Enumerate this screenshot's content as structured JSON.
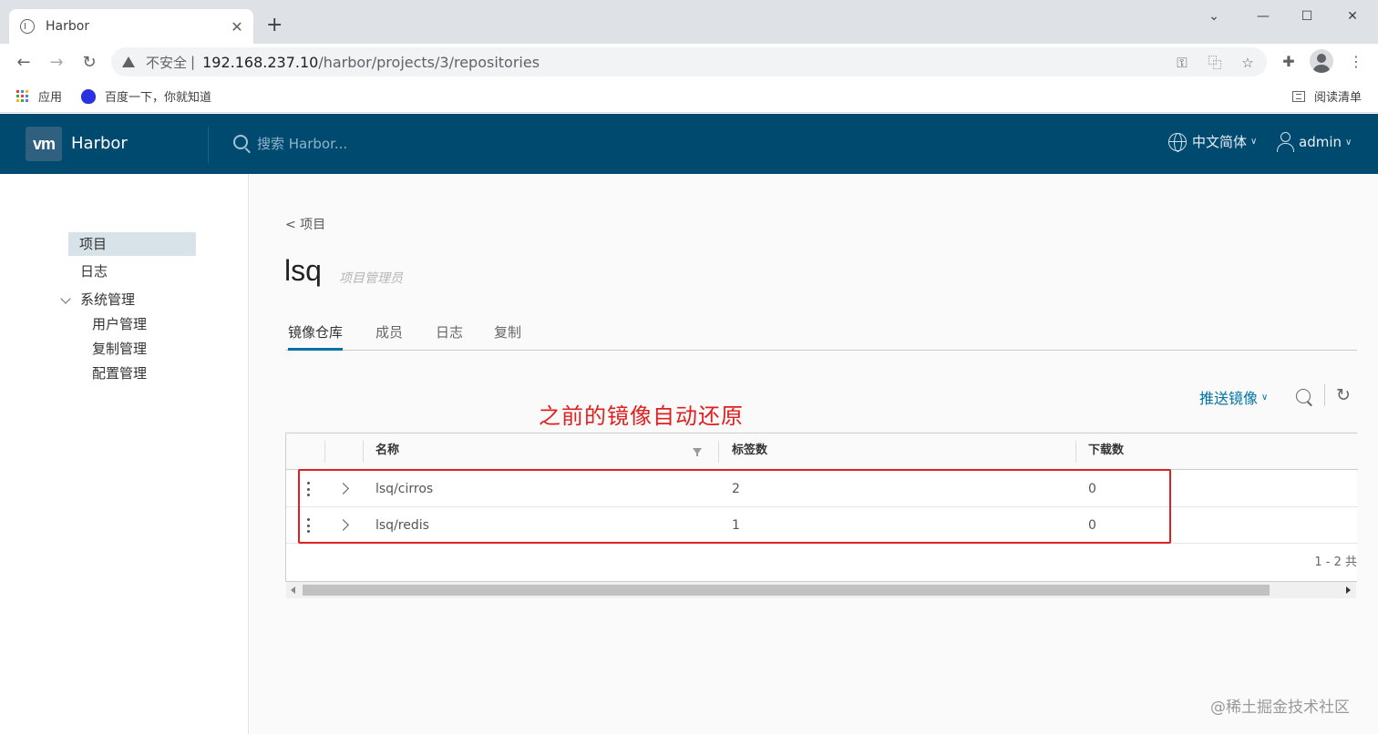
{
  "browser": {
    "tab_title": "Harbor",
    "insecure_label": "不安全",
    "url_host": "192.168.237.10",
    "url_path": "/harbor/projects/3/repositories",
    "bookmarks": [
      {
        "label": "应用"
      },
      {
        "label": "百度一下，你就知道"
      }
    ],
    "reading_list": "阅读清单"
  },
  "header": {
    "logo": "vm",
    "brand": "Harbor",
    "search_placeholder": "搜索 Harbor...",
    "language": "中文简体",
    "user": "admin",
    "color": "#004a70"
  },
  "sidebar": {
    "items": [
      {
        "label": "项目",
        "active": true
      },
      {
        "label": "日志"
      },
      {
        "label": "系统管理"
      }
    ],
    "sub_items": [
      {
        "label": "用户管理"
      },
      {
        "label": "复制管理"
      },
      {
        "label": "配置管理"
      }
    ]
  },
  "page": {
    "back_label": "< 项目",
    "project_name": "lsq",
    "role": "项目管理员",
    "tabs": [
      {
        "label": "镜像仓库",
        "active": true
      },
      {
        "label": "成员"
      },
      {
        "label": "日志"
      },
      {
        "label": "复制"
      }
    ],
    "push_label": "推送镜像",
    "annotation": "之前的镜像自动还原",
    "columns": [
      "名称",
      "标签数",
      "下载数"
    ],
    "rows": [
      {
        "name": "lsq/cirros",
        "tags": "2",
        "pulls": "0"
      },
      {
        "name": "lsq/redis",
        "tags": "1",
        "pulls": "0"
      }
    ],
    "footer": "1 - 2 共",
    "accent_color": "#0072a3",
    "annotation_color": "#e02020"
  },
  "watermark": "@稀土掘金技术社区"
}
